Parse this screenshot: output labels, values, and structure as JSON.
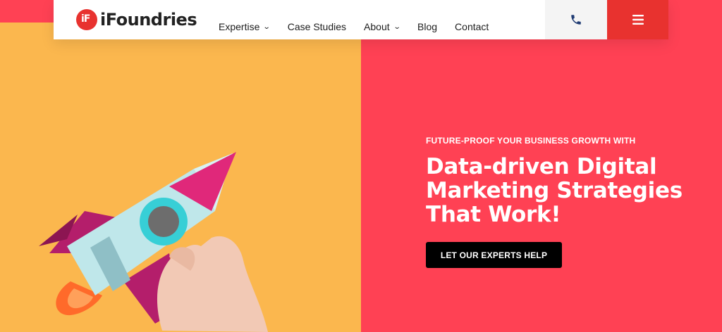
{
  "header": {
    "logo": {
      "mark": "iF",
      "name": "iFoundries"
    },
    "nav": [
      {
        "label": "Expertise",
        "has_dropdown": true
      },
      {
        "label": "Case Studies",
        "has_dropdown": false
      },
      {
        "label": "About",
        "has_dropdown": true
      },
      {
        "label": "Blog",
        "has_dropdown": false
      },
      {
        "label": "Contact",
        "has_dropdown": false
      }
    ],
    "phone_icon": "phone-icon",
    "menu_icon": "hamburger-menu-icon"
  },
  "hero": {
    "eyebrow": "FUTURE-PROOF YOUR BUSINESS GROWTH WITH",
    "headline_lines": [
      "Data-driven Digital",
      "Marketing Strategies",
      "That Work!"
    ],
    "cta_label": "LET OUR EXPERTS HELP",
    "image": "paper-rocket-in-hand"
  },
  "colors": {
    "brand_red": "#e8322f",
    "hero_pink": "#ff4154",
    "hero_yellow": "#fbb74e",
    "phone_blue": "#1f3b73"
  }
}
